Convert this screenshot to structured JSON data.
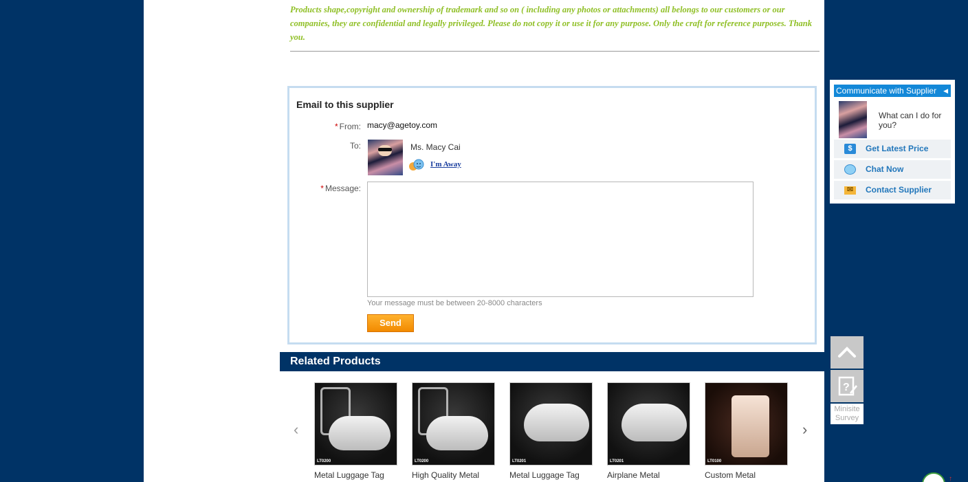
{
  "notice": {
    "text": "Products shape,copyright and ownership of trademark and so on ( including any photos or attachments)  all belongs to our customers or our companies, they are confidential and legally privileged. Please do not copy it or use it for any purpose. Only the craft for reference purposes. Thank you."
  },
  "email_form": {
    "title": "Email to this supplier",
    "required_mark": "*",
    "from_label": "From:",
    "from_value": "macy@agetoy.com",
    "to_label": "To:",
    "to_name": "Ms. Macy Cai",
    "away_status": "I'm Away",
    "message_label": "Message:",
    "message_value": "",
    "message_hint": "Your message must be between 20-8000 characters",
    "send_label": "Send"
  },
  "related": {
    "title": "Related Products",
    "products": [
      {
        "name": "Metal Luggage Tag",
        "code": "LT0200"
      },
      {
        "name": "High Quality Metal",
        "code": "LT0200"
      },
      {
        "name": "Metal Luggage Tag",
        "code": "LT0201"
      },
      {
        "name": "Airplane Metal",
        "code": "LT0201"
      },
      {
        "name": "Custom Metal",
        "code": "LT0100"
      }
    ]
  },
  "communicate": {
    "header": "Communicate with Supplier",
    "question": "What can I do for you?",
    "items": [
      {
        "label": "Get Latest Price",
        "icon": "dollar-tag-icon"
      },
      {
        "label": "Chat Now",
        "icon": "chat-face-icon"
      },
      {
        "label": "Contact Supplier",
        "icon": "envelope-icon"
      }
    ]
  },
  "side_tools": {
    "survey_label": "Minisite Survey"
  },
  "colors": {
    "background": "#003366",
    "notice_text": "#8fbf25",
    "send_button": "#f7931e",
    "comm_header": "#1388d8",
    "link_blue": "#2277bb"
  }
}
